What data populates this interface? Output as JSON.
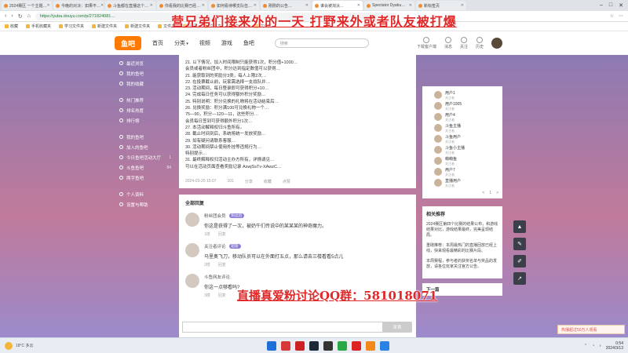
{
  "browser": {
    "tabs": [
      {
        "label": "2024赛区 一个主题…"
      },
      {
        "label": "今晚的对决：如果不…"
      },
      {
        "label": "斗鱼都在直播这个…"
      },
      {
        "label": "你看我的比赛已经…"
      },
      {
        "label": "如何看待哪支队伍…"
      },
      {
        "label": "刚刚的公告…"
      },
      {
        "label": "谁会被淘汰…",
        "active": true
      },
      {
        "label": "Spectator Dyabu…"
      },
      {
        "label": "新标签页"
      }
    ],
    "url": "https://yuba.douyu.com/p/271824081…",
    "bookmarks": [
      "收藏",
      "手机收藏夹",
      "学习文件夹",
      "新建文件夹",
      "新建文件夹",
      "文件夹",
      "网页",
      "文件夹",
      "文件夹",
      "文件夹"
    ]
  },
  "overlay": {
    "title": "营兄弟们接来外的一天 打野来外或者队友被打爆",
    "qq": "直播真爱粉讨论QQ群：581018071"
  },
  "site": {
    "logo": "鱼吧",
    "nav": [
      "首页",
      "分类",
      "视频",
      "游戏",
      "鱼吧"
    ],
    "search_placeholder": "搜索",
    "header_icons": [
      "下载客户端",
      "消息",
      "关注",
      "历史"
    ]
  },
  "sidebar": {
    "group1": [
      "最近浏览",
      "我的鱼吧",
      "我的收藏"
    ],
    "group2": [
      "热门推荐",
      "排名热度",
      "排行榜"
    ],
    "group3_title": "我的鱼吧",
    "group3": [
      {
        "label": "加入的鱼吧",
        "count": ""
      },
      {
        "label": "今日鱼吧活动大厅",
        "count": "1"
      },
      {
        "label": "斗鱼鱼吧",
        "count": "84"
      },
      {
        "label": "两字鱼吧",
        "count": ""
      }
    ],
    "group4": [
      "个人资料",
      "设置与帮助"
    ]
  },
  "post": {
    "lines": [
      "21. 以下情况，加入时间限制只能获得1次，积分值+1000…",
      "会员或者粉丝团中，积分达到指定数值可以获得…",
      "21. 能获取到的奖励分3类，每人上限2次…",
      "22. 在投票截止前，玩家需选择一支战队并…",
      "23. 活动期间，每日登录即可获得积分+10…",
      "24. 完成每日任务可以获得额外积分奖励…",
      "25. 特别说明：积分兑换的礼物将在活动结束后…",
      "26. 兑换奖励：积分满100可兑换礼物一个…",
      "      75—90，积分—120—11，这些积分…",
      "会员每日签到可获得额外积分1次…",
      "27. 本活动解释权归斗鱼所有。",
      "28. 截止时间到后，系统将统一发放奖励…",
      "29. 如有疑问请联系客服…",
      "30. 活动期间禁止使用外挂等违规行为…",
      "特别提示…",
      "31. 最终解释权归活动主办方所有，详情请见…",
      "可以在活动页面查看奖励记录 AswjSsTv-XAwzC…"
    ],
    "meta": [
      "2024-03-20 15:07",
      "101",
      "分享",
      "收藏",
      "点赞"
    ]
  },
  "comments": {
    "heading": "全部回复",
    "items": [
      {
        "user": "粉丝团会员",
        "badge": "粉丝团",
        "text": "你这是获得了一次，被奶牛们传说中的某某某的神奇魔力。",
        "meta": [
          "1楼",
          "回复"
        ]
      },
      {
        "user": "关注者评论",
        "badge": "超管",
        "text": "马里奥飞刀，移动队员可以在外面打五点，那么请去三楼看看5点儿",
        "meta": [
          "2楼",
          "回复"
        ]
      },
      {
        "user": "斗鱼网友评论",
        "badge": "",
        "text": "你这一点够看吗?",
        "meta": [
          "3楼",
          "回复"
        ]
      }
    ],
    "send_label": "发表"
  },
  "right": {
    "users": [
      {
        "name": "用户1",
        "sub": "关注者"
      },
      {
        "name": "用户1005",
        "sub": "关注者"
      },
      {
        "name": "用户4",
        "sub": "关注者"
      },
      {
        "name": "斗鱼主播",
        "sub": "关注者"
      },
      {
        "name": "斗鱼用户",
        "sub": "关注者"
      },
      {
        "name": "斗鱼小主播",
        "sub": "关注者"
      },
      {
        "name": "萌萌鱼",
        "sub": "关注者"
      },
      {
        "name": "用户7",
        "sub": "关注者"
      },
      {
        "name": "直播用户",
        "sub": "关注者"
      }
    ],
    "pager": [
      "<",
      "1",
      ">"
    ],
    "rec_title": "相关推荐",
    "rec": [
      "2024赛区第四个比赛的结果公布，和游戏结果对比，游戏结果最终，完美呈现结局。",
      "重磅推荐：本周最热门的直播回放已经上线，快来观看最精彩的比赛片段。",
      "本周赛程，参与者的获奖名单与奖品的发放，请各位玩家关注官方公告。"
    ],
    "next_label": "下一篇"
  },
  "float_buttons": [
    "up-arrow",
    "comment",
    "edit",
    "share"
  ],
  "notice": "热播超过50万人观看",
  "taskbar": {
    "weather": "18°C 多云",
    "time": "0:54",
    "date": "2024/3/13"
  }
}
